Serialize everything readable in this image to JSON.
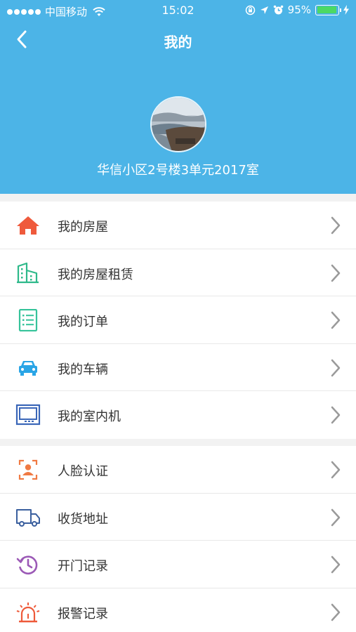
{
  "status_bar": {
    "carrier": "中国移动",
    "time": "15:02",
    "battery_percent": "95%"
  },
  "navbar": {
    "title": "我的"
  },
  "profile": {
    "address": "华信小区2号楼3单元2017室"
  },
  "menu_group_1": [
    {
      "label": "我的房屋",
      "icon": "house-icon"
    },
    {
      "label": "我的房屋租赁",
      "icon": "building-icon"
    },
    {
      "label": "我的订单",
      "icon": "list-icon"
    },
    {
      "label": "我的车辆",
      "icon": "car-icon"
    },
    {
      "label": "我的室内机",
      "icon": "monitor-icon"
    }
  ],
  "menu_group_2": [
    {
      "label": "人脸认证",
      "icon": "face-scan-icon"
    },
    {
      "label": "收货地址",
      "icon": "truck-icon"
    },
    {
      "label": "开门记录",
      "icon": "history-icon"
    },
    {
      "label": "报警记录",
      "icon": "alarm-icon"
    }
  ],
  "colors": {
    "header": "#4cb4e7",
    "house": "#ef5a3c",
    "building": "#2eb98a",
    "list": "#35c39a",
    "car": "#2aa5e6",
    "monitor": "#3a66b8",
    "face": "#f07a43",
    "truck": "#3a5f9e",
    "history": "#9b59b6",
    "alarm": "#ee5a3a"
  }
}
